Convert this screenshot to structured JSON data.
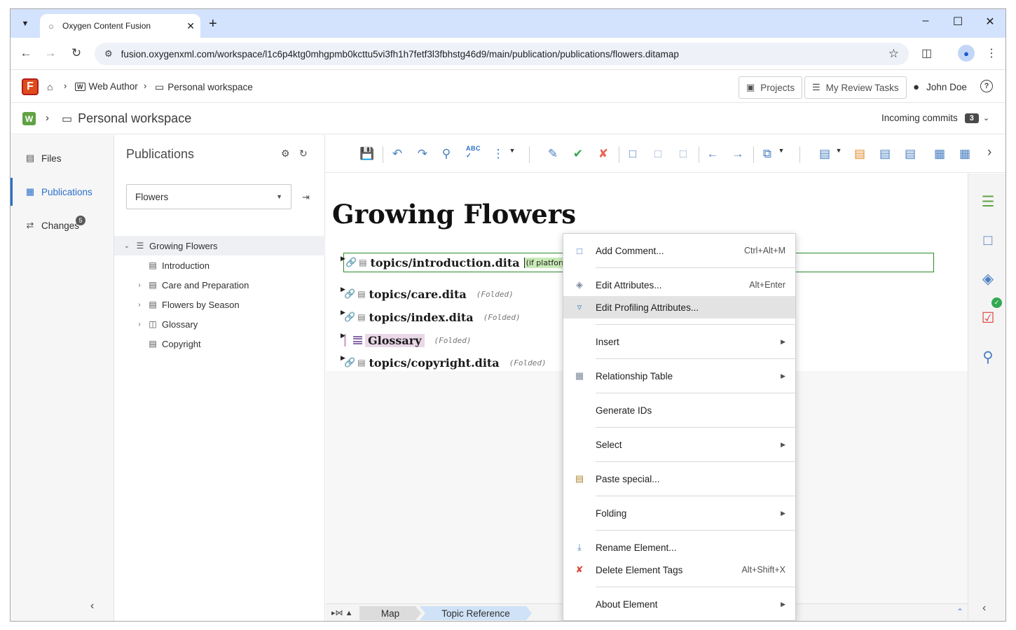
{
  "browser": {
    "tab_title": "Oxygen Content Fusion",
    "url": "fusion.oxygenxml.com/workspace/l1c6p4ktg0mhgpmb0kcttu5vi3fh1h7fetf3l3fbhstg46d9/main/publication/publications/flowers.ditamap"
  },
  "header": {
    "logo_letter": "F",
    "crumb_web_author": "Web Author",
    "crumb_workspace": "Personal workspace",
    "projects_label": "Projects",
    "review_tasks_label": "My Review Tasks",
    "user_name": "John Doe"
  },
  "workspace": {
    "logo_letter": "W",
    "name": "Personal workspace",
    "incoming_commits_label": "Incoming commits",
    "incoming_commits_count": "3"
  },
  "leftnav": {
    "items": [
      {
        "label": "Files",
        "icon": "file-icon"
      },
      {
        "label": "Publications",
        "icon": "publications-icon"
      },
      {
        "label": "Changes",
        "icon": "changes-icon",
        "badge": "5"
      }
    ]
  },
  "publications": {
    "title": "Publications",
    "selected": "Flowers",
    "tree": [
      {
        "label": "Growing Flowers",
        "expanded": true
      },
      {
        "label": "Introduction"
      },
      {
        "label": "Care and Preparation"
      },
      {
        "label": "Flowers by Season"
      },
      {
        "label": "Glossary"
      },
      {
        "label": "Copyright"
      }
    ]
  },
  "editor": {
    "title": "Growing Flowers",
    "topicrefs": [
      {
        "href": "topics/introduction.dita",
        "condition": "(if platform"
      },
      {
        "href": "topics/care.dita",
        "folded": "(Folded)"
      },
      {
        "href": "topics/index.dita",
        "folded": "(Folded)"
      },
      {
        "href": "Glossary",
        "folded": "(Folded)"
      },
      {
        "href": "topics/copyright.dita",
        "folded": "(Folded)"
      }
    ]
  },
  "statusbar": {
    "segments": [
      "Map",
      "Topic Reference"
    ]
  },
  "context_menu": {
    "items": [
      {
        "label": "Add Comment...",
        "shortcut": "Ctrl+Alt+M",
        "icon": "add-comment-icon"
      },
      {
        "label": "Edit Attributes...",
        "shortcut": "Alt+Enter",
        "icon": "tag-icon"
      },
      {
        "label": "Edit Profiling Attributes...",
        "icon": "filter-icon"
      },
      {
        "label": "Insert"
      },
      {
        "label": "Relationship Table",
        "icon": "reltable-icon"
      },
      {
        "label": "Generate IDs"
      },
      {
        "label": "Select"
      },
      {
        "label": "Paste special...",
        "icon": "paste-icon"
      },
      {
        "label": "Folding"
      },
      {
        "label": "Rename Element...",
        "icon": "rename-icon"
      },
      {
        "label": "Delete Element Tags",
        "shortcut": "Alt+Shift+X",
        "icon": "delete-tags-icon"
      },
      {
        "label": "About Element"
      }
    ]
  }
}
